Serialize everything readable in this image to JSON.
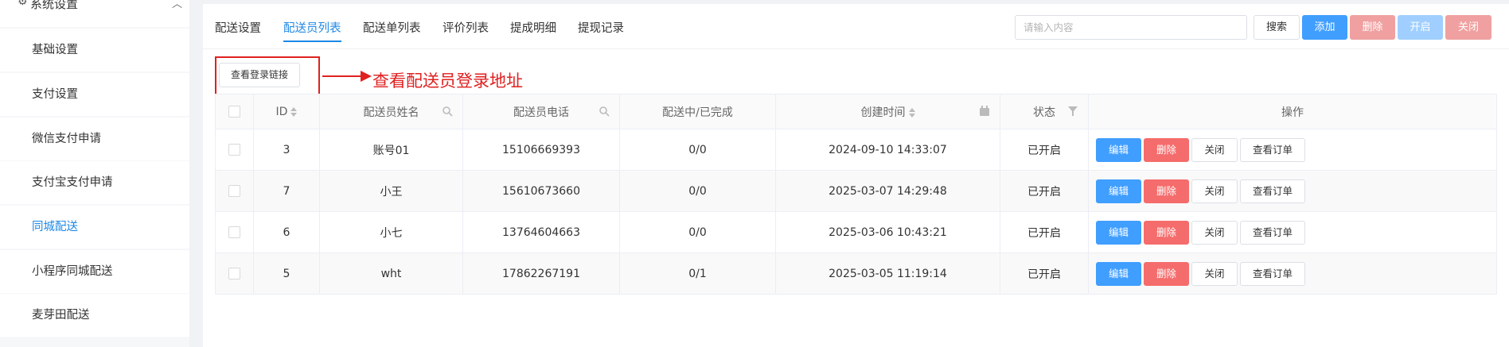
{
  "sidebar": {
    "section_title": "系统设置",
    "items": [
      {
        "label": "基础设置",
        "active": false
      },
      {
        "label": "支付设置",
        "active": false
      },
      {
        "label": "微信支付申请",
        "active": false
      },
      {
        "label": "支付宝支付申请",
        "active": false
      },
      {
        "label": "同城配送",
        "active": true
      },
      {
        "label": "小程序同城配送",
        "active": false
      },
      {
        "label": "麦芽田配送",
        "active": false
      }
    ]
  },
  "tabs": [
    {
      "label": "配送设置",
      "active": false
    },
    {
      "label": "配送员列表",
      "active": true
    },
    {
      "label": "配送单列表",
      "active": false
    },
    {
      "label": "评价列表",
      "active": false
    },
    {
      "label": "提成明细",
      "active": false
    },
    {
      "label": "提现记录",
      "active": false
    }
  ],
  "toolbar": {
    "search_placeholder": "请输入内容",
    "search_label": "搜索",
    "add_label": "添加",
    "delete_label": "删除",
    "enable_label": "开启",
    "close_label": "关闭"
  },
  "login_link_button": "查看登录链接",
  "annotation": "查看配送员登录地址",
  "table": {
    "columns": [
      "ID",
      "配送员姓名",
      "配送员电话",
      "配送中/已完成",
      "创建时间",
      "状态",
      "操作"
    ],
    "rows": [
      {
        "id": "3",
        "name": "账号01",
        "phone": "15106669393",
        "progress": "0/0",
        "created": "2024-09-10 14:33:07",
        "status": "已开启"
      },
      {
        "id": "7",
        "name": "小王",
        "phone": "15610673660",
        "progress": "0/0",
        "created": "2025-03-07 14:29:48",
        "status": "已开启"
      },
      {
        "id": "6",
        "name": "小七",
        "phone": "13764604663",
        "progress": "0/0",
        "created": "2025-03-06 10:43:21",
        "status": "已开启"
      },
      {
        "id": "5",
        "name": "wht",
        "phone": "17862267191",
        "progress": "0/1",
        "created": "2025-03-05 11:19:14",
        "status": "已开启"
      }
    ],
    "actions": {
      "edit": "编辑",
      "delete": "删除",
      "close": "关闭",
      "orders": "查看订单"
    }
  },
  "colors": {
    "accent": "#1e88e5",
    "danger": "#f56c6c",
    "annotation": "#e02020"
  }
}
